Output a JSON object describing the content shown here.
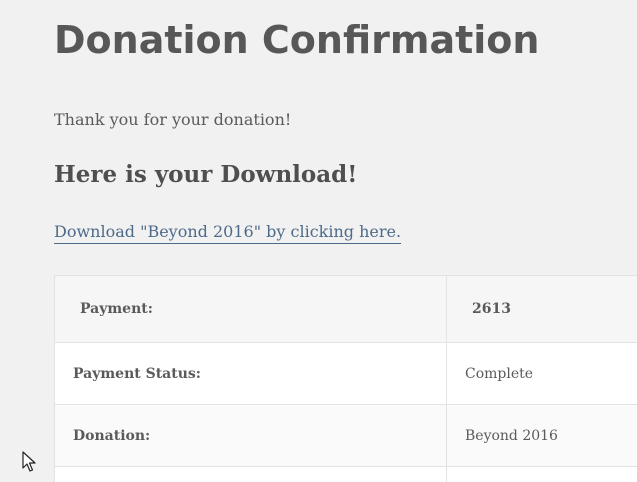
{
  "page": {
    "title": "Donation Confirmation",
    "thanks_message": "Thank you for your donation!",
    "download_heading": "Here is your Download!",
    "download_link_text": "Download \"Beyond 2016\" by clicking here."
  },
  "receipt": {
    "header": {
      "label": "Payment:",
      "value": "2613"
    },
    "rows": [
      {
        "label": "Payment Status:",
        "value": "Complete"
      },
      {
        "label": "Donation:",
        "value": "Beyond 2016"
      }
    ]
  },
  "colors": {
    "background": "#f1f1f1",
    "link": "#4d6a89",
    "text": "#555555"
  },
  "icons": [
    "mouse-cursor-icon"
  ]
}
